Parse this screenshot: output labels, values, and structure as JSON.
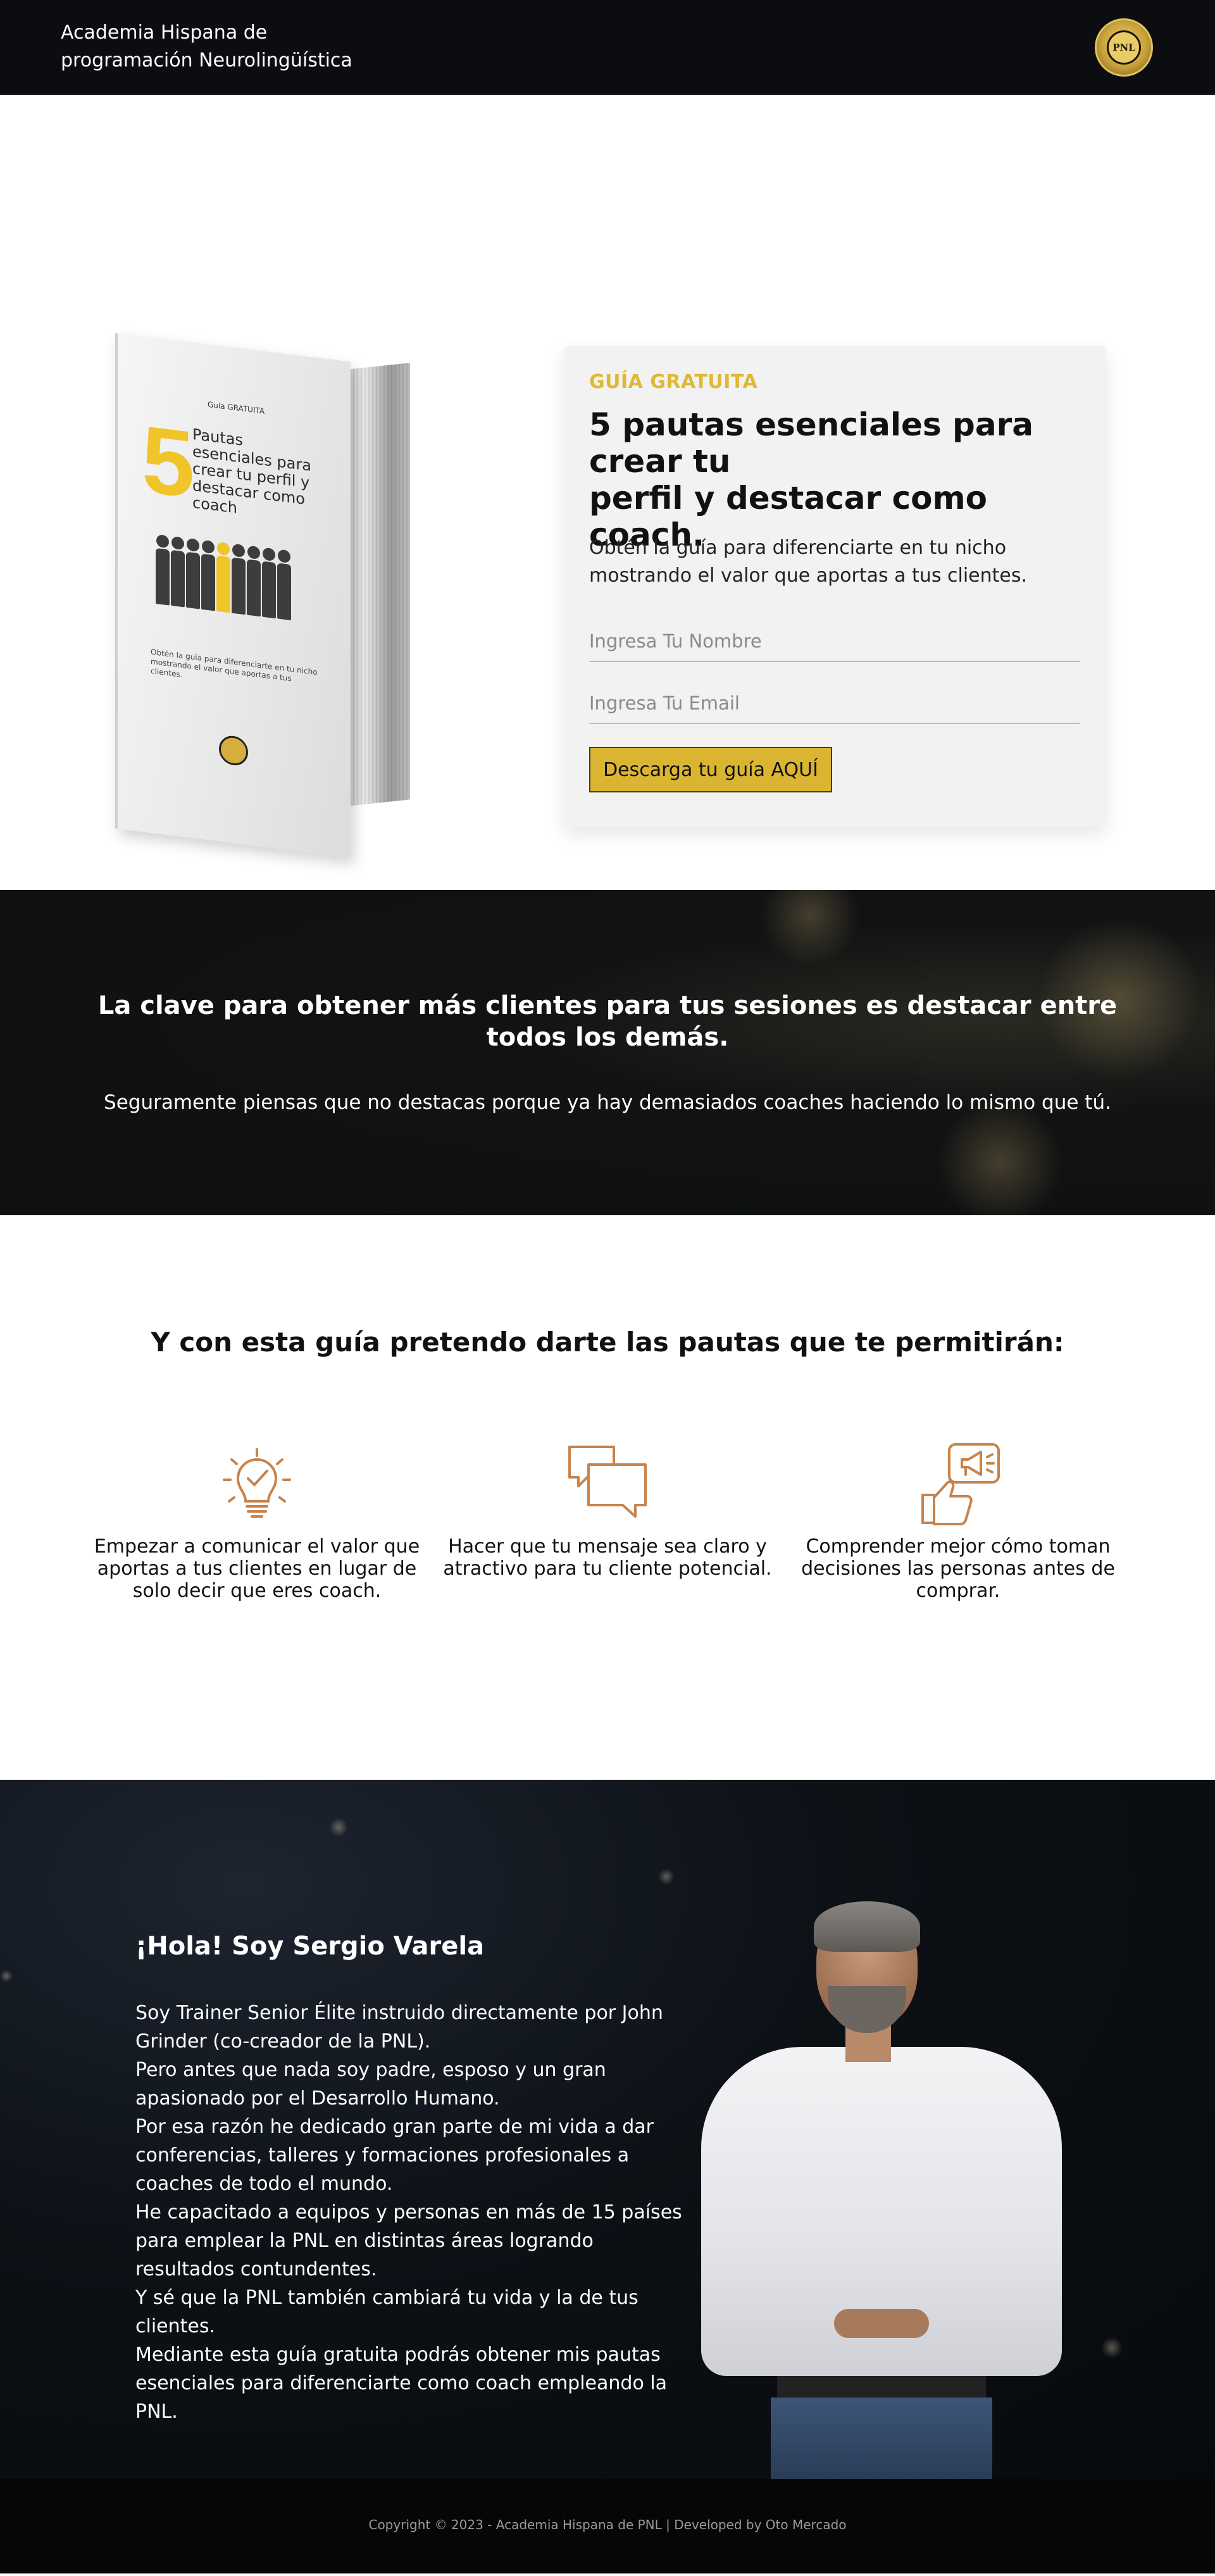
{
  "header": {
    "brand_line1": "Academia Hispana de",
    "brand_line2": "programación Neurolingüística",
    "logo_text": "PNL"
  },
  "hero": {
    "book": {
      "label": "Guía GRATUITA",
      "number": "5",
      "title": "Pautas esenciales para crear tu perfil y destacar como coach",
      "description": "Obtén la guía para diferenciarte en tu nicho mostrando el valor que aportas a tus clientes."
    },
    "kicker": "GUÍA GRATUITA",
    "title_line1": "5 pautas esenciales para crear tu",
    "title_line2": "perfil y destacar como coach.",
    "description": "Obtén la guía para diferenciarte en tu nicho mostrando el valor que aportas a tus clientes.",
    "name_placeholder": "Ingresa Tu Nombre",
    "email_placeholder": "Ingresa Tu Email",
    "cta_label": "Descarga tu guía AQUÍ"
  },
  "band": {
    "heading": "La clave para obtener más clientes para tus sesiones es destacar entre todos los demás.",
    "subtext": "Seguramente piensas que no destacas porque ya hay demasiados coaches haciendo lo mismo que tú."
  },
  "benefits": {
    "heading": "Y con esta guía pretendo darte las pautas que te permitirán:",
    "accent_color": "#c8834a",
    "items": [
      {
        "icon": "lightbulb-icon",
        "text": "Empezar a comunicar el valor que aportas a tus clientes en lugar de solo decir que eres coach."
      },
      {
        "icon": "chat-bubbles-icon",
        "text": "Hacer que tu mensaje sea claro y atractivo para tu cliente potencial."
      },
      {
        "icon": "thumbs-up-megaphone-icon",
        "text": "Comprender mejor cómo toman decisiones las personas antes de comprar."
      }
    ]
  },
  "about": {
    "heading": "¡Hola! Soy Sergio Varela",
    "paragraphs": [
      "Soy Trainer Senior Élite instruido directamente por John Grinder (co-creador de la PNL).",
      "Pero antes que nada soy padre, esposo y un gran apasionado por el Desarrollo Humano.",
      "Por esa razón he dedicado gran parte de mi vida a dar conferencias, talleres y formaciones profesionales a coaches de todo el mundo.",
      "He capacitado a equipos y personas en más de 15 países para emplear la PNL en distintas áreas logrando resultados contundentes.",
      "Y sé que la PNL también cambiará tu vida y la de tus clientes.",
      "Mediante esta guía gratuita podrás obtener mis pautas esenciales para diferenciarte como coach empleando la PNL."
    ]
  },
  "footer": {
    "text": "Copyright © 2023 - Academia Hispana de PNL | Developed by Oto Mercado"
  },
  "colors": {
    "brand_gold": "#dbb532",
    "dark_bg": "#0b0d10",
    "icon_accent": "#c8834a"
  }
}
